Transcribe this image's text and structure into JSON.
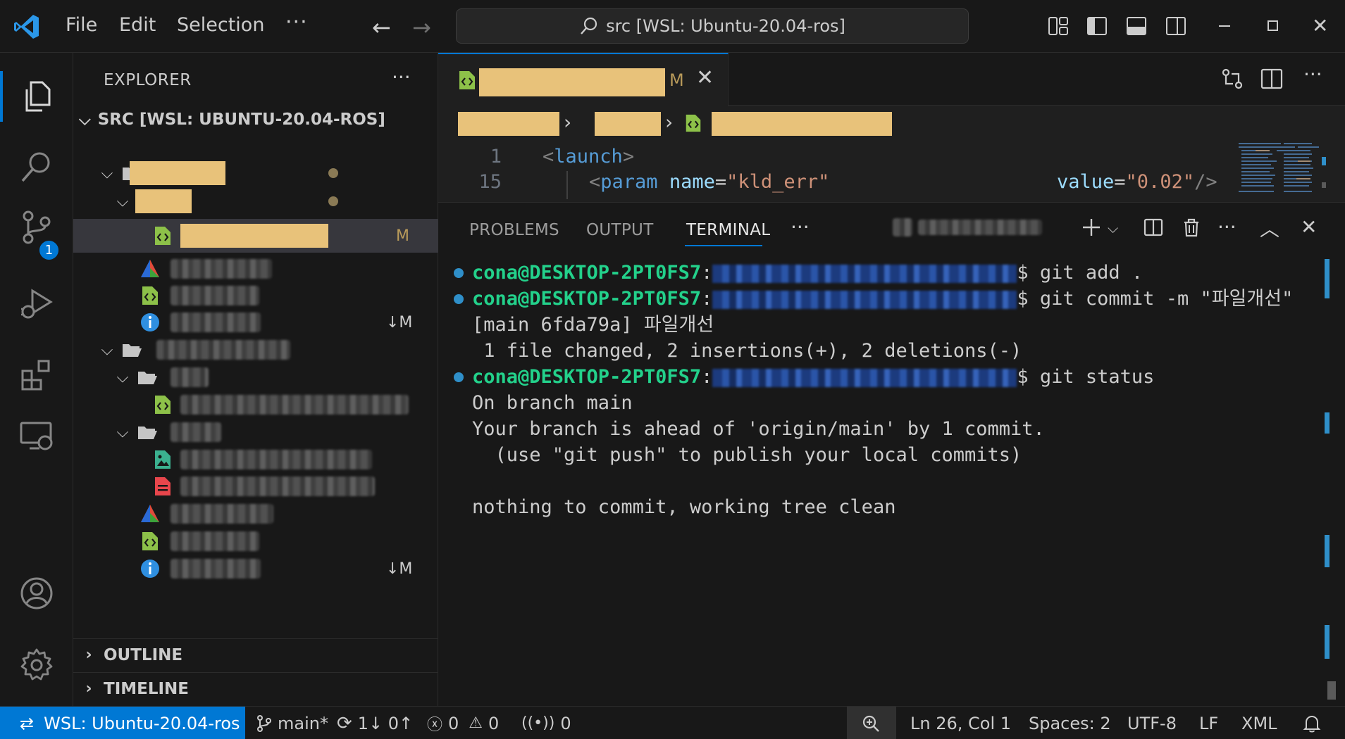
{
  "titlebar": {
    "menu": [
      "File",
      "Edit",
      "Selection",
      "···"
    ],
    "search_text": "src [WSL: Ubuntu-20.04-ros]"
  },
  "activitybar": {
    "scm_badge": "1",
    "icons": [
      "explorer-icon",
      "search-icon",
      "source-control-icon",
      "run-debug-icon",
      "extensions-icon",
      "remote-explorer-icon",
      "account-icon",
      "settings-gear-icon"
    ]
  },
  "sidebar": {
    "title": "EXPLORER",
    "more": "···",
    "root": "SRC [WSL: UBUNTU-20.04-ROS]",
    "open_file_decoration": "M",
    "readme_decoration_1": "↓M",
    "readme_decoration_2": "↓M",
    "sections": [
      "OUTLINE",
      "TIMELINE"
    ]
  },
  "editor": {
    "tab_decoration": "M",
    "lines": [
      {
        "number": "1",
        "tag": "launch"
      },
      {
        "number": "15",
        "tag": "param",
        "attr_name": "name",
        "attr_name_value": "\"kld_err\"",
        "attr_value": "value",
        "attr_value_value": "\"0.02\""
      }
    ]
  },
  "panel": {
    "tabs": [
      "PROBLEMS",
      "OUTPUT",
      "TERMINAL"
    ],
    "more": "···",
    "terminal": {
      "prompt_user": "cona@DESKTOP-2PT0FS7",
      "lines": [
        {
          "type": "cmd",
          "command": "$ git add ."
        },
        {
          "type": "cmd",
          "command": "$ git commit -m \"파일개선\""
        },
        {
          "type": "out",
          "text": "[main 6fda79a] 파일개선"
        },
        {
          "type": "out",
          "text": " 1 file changed, 2 insertions(+), 2 deletions(-)"
        },
        {
          "type": "cmd",
          "command": "$ git status"
        },
        {
          "type": "out",
          "text": "On branch main"
        },
        {
          "type": "out",
          "text": "Your branch is ahead of 'origin/main' by 1 commit."
        },
        {
          "type": "out",
          "text": "  (use \"git push\" to publish your local commits)"
        },
        {
          "type": "out",
          "text": ""
        },
        {
          "type": "out",
          "text": "nothing to commit, working tree clean"
        }
      ]
    }
  },
  "statusbar": {
    "remote": "WSL: Ubuntu-20.04-ros",
    "branch": "main*",
    "sync": "1↓ 0↑",
    "errors": "0",
    "warnings": "0",
    "ports": "0",
    "position": "Ln 26, Col 1",
    "spaces": "Spaces: 2",
    "encoding": "UTF-8",
    "eol": "LF",
    "language": "XML"
  },
  "colors": {
    "accent": "#0078d4",
    "prompt": "#23d18b",
    "redaction": "#e8c27a"
  }
}
